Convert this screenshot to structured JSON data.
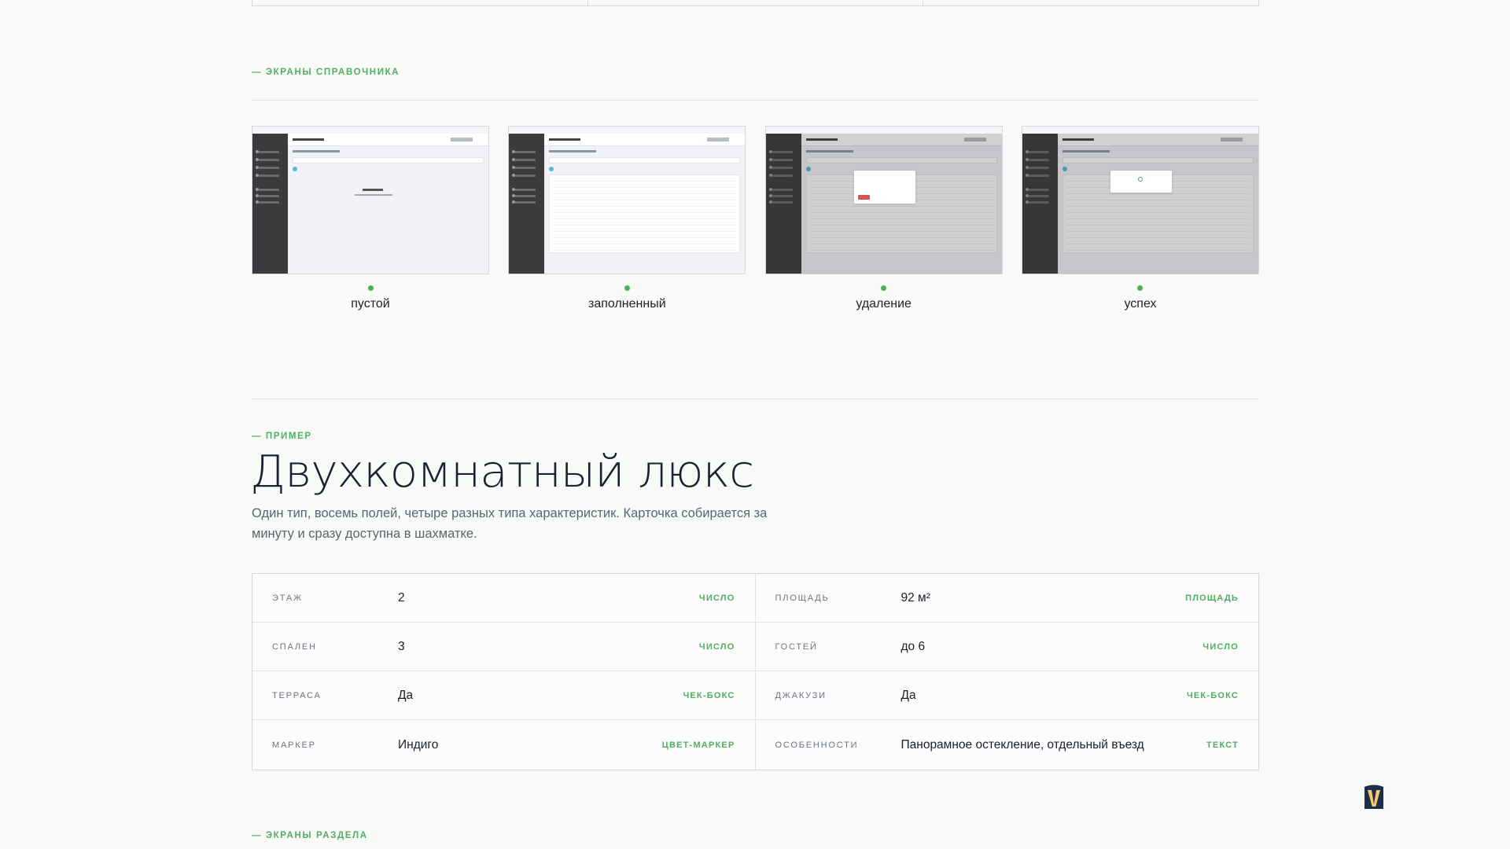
{
  "sections": {
    "screens_eyebrow": "— ЭКРАНЫ СПРАВОЧНИКА",
    "example_eyebrow": "— ПРИМЕР",
    "section_eyebrow": "— ЭКРАНЫ РАЗДЕЛА"
  },
  "screens": [
    {
      "label": "пустой",
      "state": "empty"
    },
    {
      "label": "заполненный",
      "state": "filled"
    },
    {
      "label": "удаление",
      "state": "delete"
    },
    {
      "label": "успех",
      "state": "success"
    }
  ],
  "example": {
    "title": "Двухкомнатный люкс",
    "description": "Один тип, восемь полей, четыре разных типа характеристик. Карточка собирается за минуту и сразу доступна в шахматке."
  },
  "properties": [
    {
      "key": "ЭТАЖ",
      "value": "2",
      "type": "ЧИСЛО"
    },
    {
      "key": "ПЛОЩАДЬ",
      "value": "92 м²",
      "type": "ПЛОЩАДЬ"
    },
    {
      "key": "СПАЛЕН",
      "value": "3",
      "type": "ЧИСЛО"
    },
    {
      "key": "ГОСТЕЙ",
      "value": "до 6",
      "type": "ЧИСЛО"
    },
    {
      "key": "ТЕРРАСА",
      "value": "Да",
      "type": "ЧЕК-БОКС"
    },
    {
      "key": "ДЖАКУЗИ",
      "value": "Да",
      "type": "ЧЕК-БОКС"
    },
    {
      "key": "МАРКЕР",
      "value": "Индиго",
      "type": "ЦВЕТ-МАРКЕР"
    },
    {
      "key": "ОСОБЕННОСТИ",
      "value": "Панорамное остекление, отдельный въезд",
      "type": "ТЕКСТ"
    }
  ],
  "colors": {
    "accent": "#4fae63",
    "text": "#1a2030",
    "muted": "#5c6470",
    "background": "#f8faf8"
  },
  "icons": {
    "status_dot": "green-dot-icon",
    "brand": "shield-logo-icon"
  }
}
